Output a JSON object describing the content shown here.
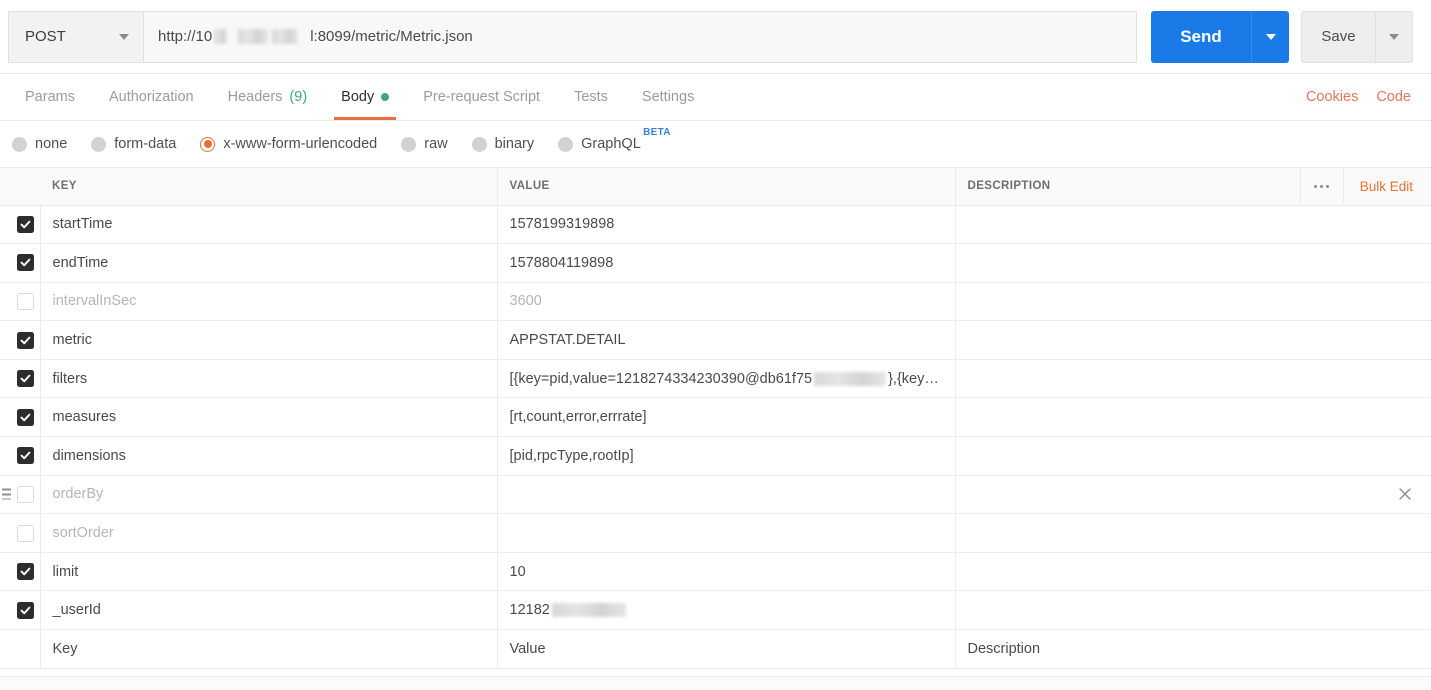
{
  "request": {
    "method": "POST",
    "url_prefix": "http://10",
    "url_suffix": "l:8099/metric/Metric.json",
    "url_full_visible": "http://10     l:8099/metric/Metric.json",
    "send_label": "Send",
    "save_label": "Save"
  },
  "tabs": [
    {
      "label": "Params",
      "active": false
    },
    {
      "label": "Authorization",
      "active": false
    },
    {
      "label": "Headers",
      "count": "(9)",
      "active": false
    },
    {
      "label": "Body",
      "active": true,
      "dot": true
    },
    {
      "label": "Pre-request Script",
      "active": false
    },
    {
      "label": "Tests",
      "active": false
    },
    {
      "label": "Settings",
      "active": false
    }
  ],
  "tabs_right": {
    "cookies_label": "Cookies",
    "code_label": "Code"
  },
  "body_types": [
    {
      "label": "none",
      "selected": false
    },
    {
      "label": "form-data",
      "selected": false
    },
    {
      "label": "x-www-form-urlencoded",
      "selected": true
    },
    {
      "label": "raw",
      "selected": false
    },
    {
      "label": "binary",
      "selected": false
    },
    {
      "label": "GraphQL",
      "selected": false,
      "badge": "BETA"
    }
  ],
  "table": {
    "headers": {
      "key": "KEY",
      "value": "VALUE",
      "description": "DESCRIPTION"
    },
    "bulk_edit_label": "Bulk Edit",
    "rows": [
      {
        "checked": true,
        "key": "startTime",
        "value": "1578199319898",
        "description": ""
      },
      {
        "checked": true,
        "key": "endTime",
        "value": "1578804119898",
        "description": ""
      },
      {
        "checked": false,
        "key": "intervalInSec",
        "value": "3600",
        "description": ""
      },
      {
        "checked": true,
        "key": "metric",
        "value": "APPSTAT.DETAIL",
        "description": ""
      },
      {
        "checked": true,
        "key": "filters",
        "value_prefix": "[{key=pid,value=1218274334230390@db61f75",
        "value_suffix": "},{key…",
        "description": ""
      },
      {
        "checked": true,
        "key": "measures",
        "value": "[rt,count,error,errrate]",
        "description": ""
      },
      {
        "checked": true,
        "key": "dimensions",
        "value": "[pid,rpcType,rootIp]",
        "description": ""
      },
      {
        "checked": false,
        "key": "orderBy",
        "value": "",
        "description": "",
        "hovered": true
      },
      {
        "checked": false,
        "key": "sortOrder",
        "value": "",
        "description": ""
      },
      {
        "checked": true,
        "key": "limit",
        "value": "10",
        "description": ""
      },
      {
        "checked": true,
        "key": "_userId",
        "value_prefix": "12182",
        "value_suffix": "",
        "description": ""
      }
    ],
    "placeholder_row": {
      "key": "Key",
      "value": "Value",
      "description": "Description"
    }
  },
  "colors": {
    "accent_orange": "#e8703a",
    "send_blue": "#1a7ae8",
    "green": "#3ba97a",
    "beta_blue": "#3b82d6"
  }
}
